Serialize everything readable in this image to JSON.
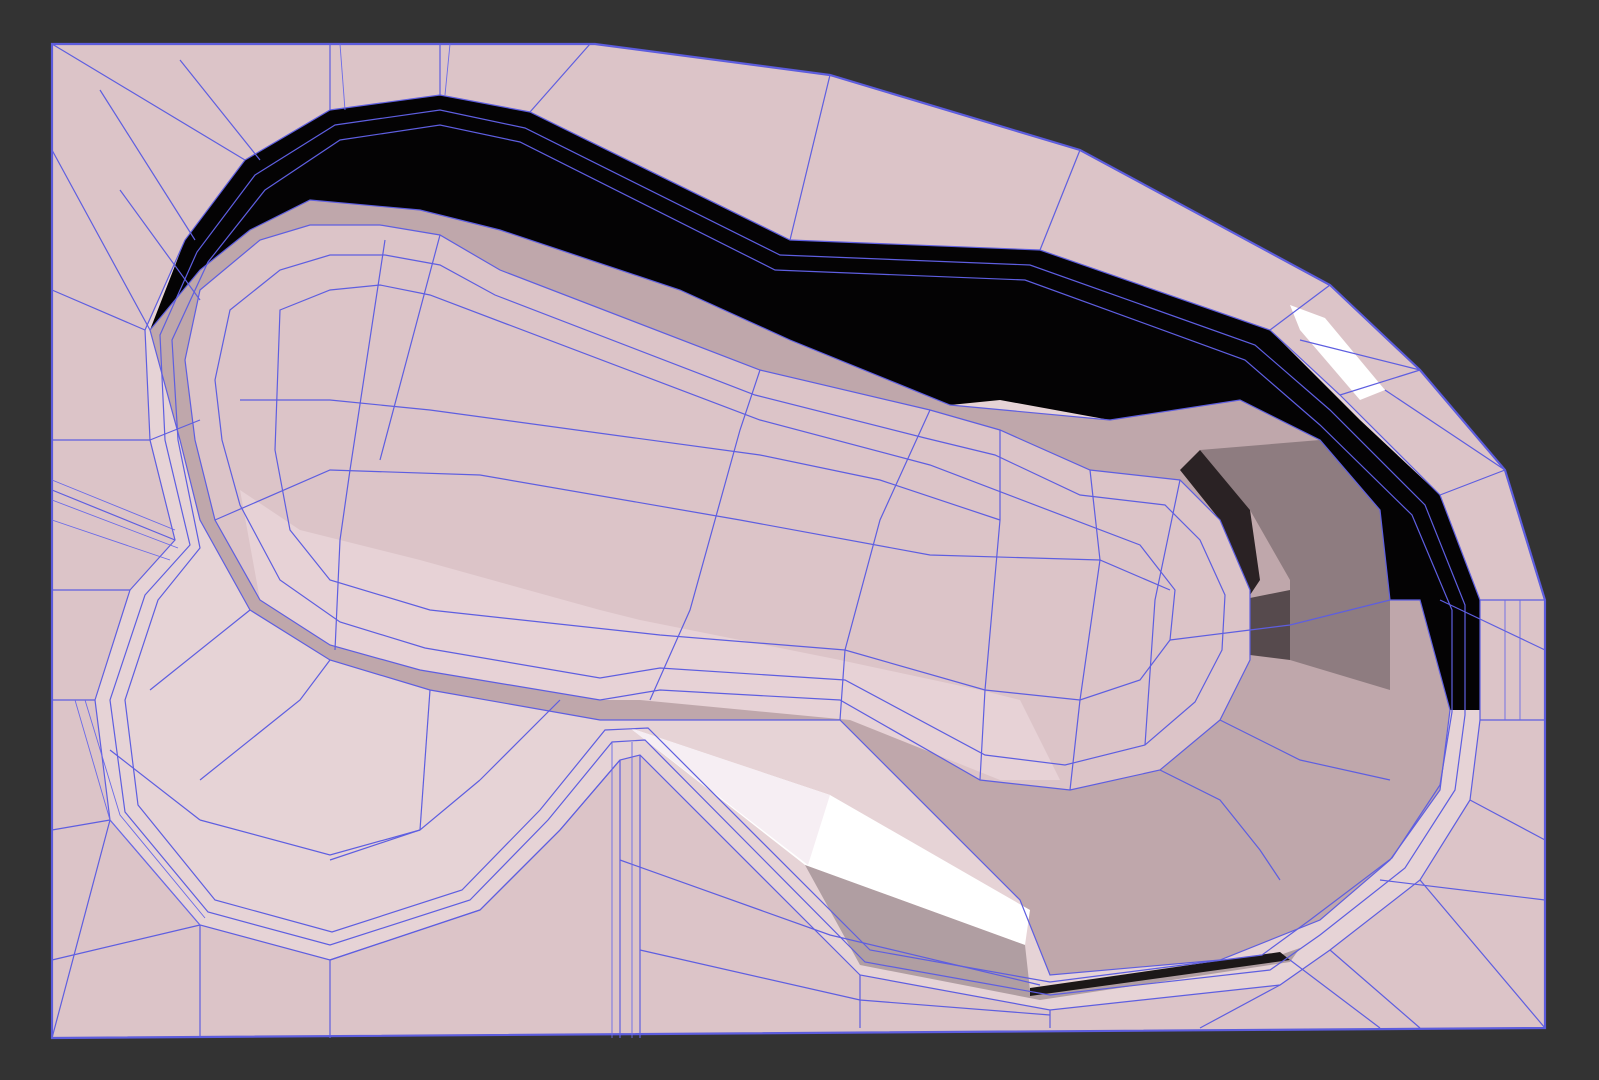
{
  "viewport": {
    "background": "#333333",
    "mode": "wireframe-on-shaded"
  },
  "mesh": {
    "name": "",
    "colors": {
      "surface": "#dcc4c8",
      "surface_light": "#e7d2d6",
      "wall_mid": "#c2a9ad",
      "wall_dark": "#9f8a8d",
      "shadow": "#000000",
      "highlight": "#ffffff",
      "wireframe": "#5e5ee0"
    }
  }
}
